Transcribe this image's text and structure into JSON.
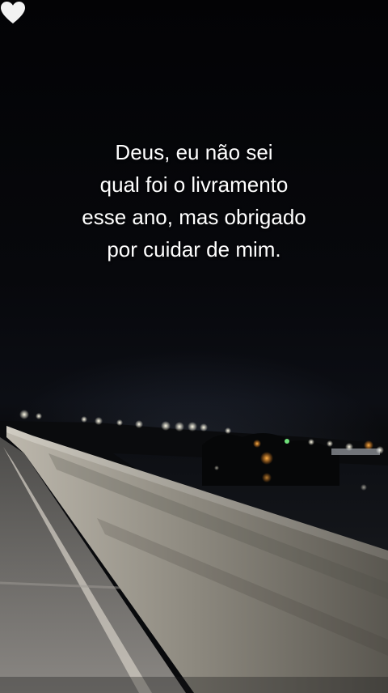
{
  "caption": {
    "lines": [
      "Deus, eu não sei",
      "qual foi o livramento",
      "esse ano, mas obrigado",
      "por cuidar de mim."
    ],
    "emoji": "white-heart-icon"
  },
  "colors": {
    "sky": "#050507",
    "text": "#ffffff",
    "heart": "#f2f2f2",
    "city_lights": "#fff6d8",
    "barrier": "#9a968c",
    "road": "#6f6d69"
  }
}
